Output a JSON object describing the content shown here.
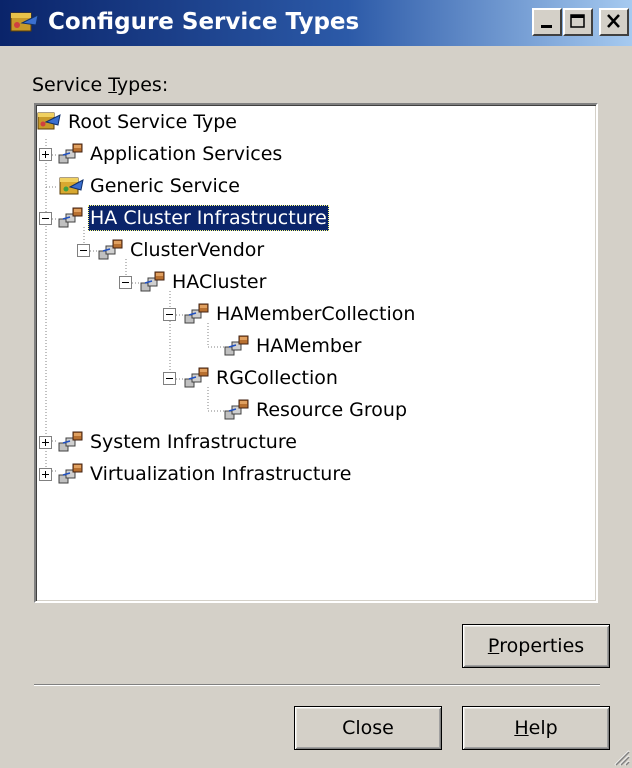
{
  "window": {
    "title": "Configure Service Types",
    "icon": "service-types-icon"
  },
  "caption_buttons": [
    "minimize",
    "maximize",
    "close"
  ],
  "label": {
    "text_before": "Service ",
    "mnemonic": "T",
    "text_after": "ypes:"
  },
  "tree": {
    "nodes": [
      {
        "label": "Root Service Type",
        "icon": "root-service-icon",
        "depth": 0,
        "expander": "none"
      },
      {
        "label": "Application Services",
        "icon": "service-network-icon",
        "depth": 1,
        "expander": "plus"
      },
      {
        "label": "Generic Service",
        "icon": "generic-service-icon",
        "depth": 1,
        "expander": "none"
      },
      {
        "label": "HA Cluster Infrastructure",
        "icon": "service-network-icon",
        "depth": 1,
        "expander": "minus",
        "selected": true
      },
      {
        "label": "ClusterVendor",
        "icon": "service-network-icon",
        "depth": 2,
        "expander": "minus"
      },
      {
        "label": "HACluster",
        "icon": "service-network-icon",
        "depth": 3,
        "expander": "minus"
      },
      {
        "label": "HAMemberCollection",
        "icon": "service-network-icon",
        "depth": 4,
        "expander": "minus"
      },
      {
        "label": "HAMember",
        "icon": "service-network-icon",
        "depth": 5,
        "expander": "none"
      },
      {
        "label": "RGCollection",
        "icon": "service-network-icon",
        "depth": 4,
        "expander": "minus"
      },
      {
        "label": "Resource Group",
        "icon": "service-network-icon",
        "depth": 5,
        "expander": "none"
      },
      {
        "label": "System Infrastructure",
        "icon": "service-network-icon",
        "depth": 1,
        "expander": "plus"
      },
      {
        "label": "Virtualization Infrastructure",
        "icon": "service-network-icon",
        "depth": 1,
        "expander": "plus"
      }
    ]
  },
  "buttons": {
    "properties": {
      "mnemonic": "P",
      "rest": "roperties"
    },
    "close": {
      "label": "Close"
    },
    "help": {
      "mnemonic": "H",
      "rest": "elp"
    }
  },
  "colors": {
    "title_start": "#0a246a",
    "title_end": "#a6caf0",
    "selection": "#0a246a",
    "face": "#d4d0c8"
  }
}
